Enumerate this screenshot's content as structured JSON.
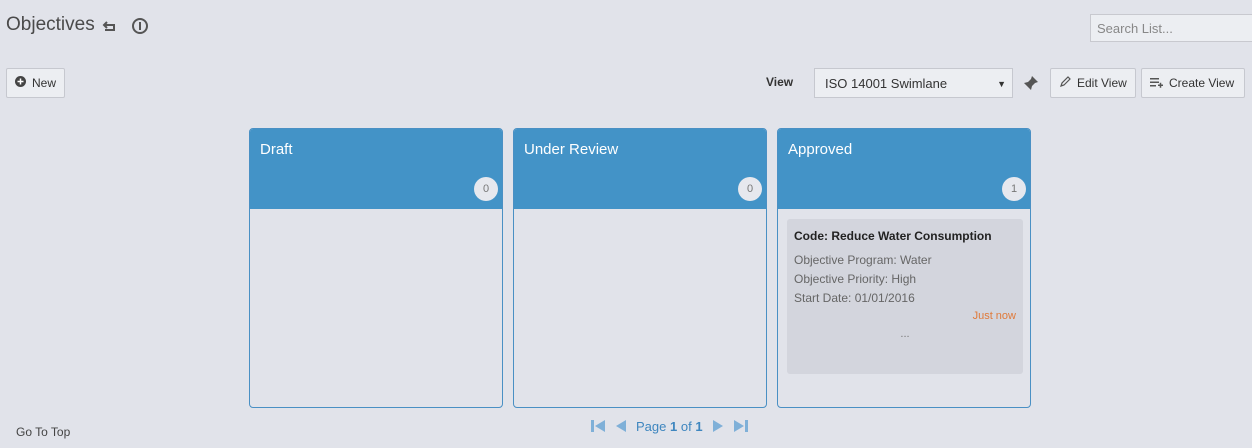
{
  "header": {
    "title": "Objectives"
  },
  "search": {
    "placeholder": "Search List..."
  },
  "toolbar": {
    "new_label": "New",
    "view_label": "View",
    "view_selected": "ISO 14001 Swimlane",
    "edit_view_label": "Edit View",
    "create_view_label": "Create View"
  },
  "columns": [
    {
      "title": "Draft",
      "count": "0"
    },
    {
      "title": "Under Review",
      "count": "0"
    },
    {
      "title": "Approved",
      "count": "1"
    }
  ],
  "card": {
    "title": "Code: Reduce Water Consumption",
    "program": "Objective Program: Water",
    "priority": "Objective Priority: High",
    "start_date": "Start Date: 01/01/2016",
    "time": "Just now",
    "more": "..."
  },
  "pagination": {
    "page_word": "Page",
    "current": "1",
    "of_word": "of",
    "total": "1"
  },
  "footer": {
    "go_to_top": "Go To Top"
  },
  "colors": {
    "column_header": "#4393c7",
    "background": "#e1e3ea",
    "card": "#d3d5dd",
    "time_accent": "#e07a3a"
  }
}
